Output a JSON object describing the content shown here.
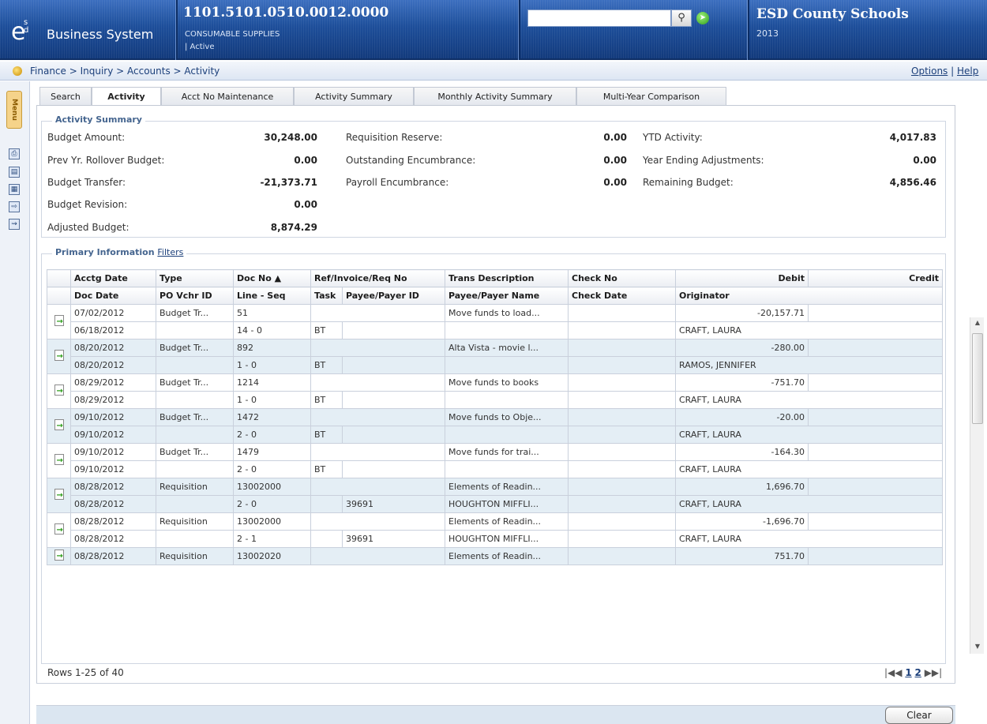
{
  "header": {
    "logo_text": "Business System",
    "account_number": "1101.5101.0510.0012.0000",
    "account_desc": "CONSUMABLE SUPPLIES",
    "account_status": "| Active",
    "district": "ESD County Schools",
    "year": "2013",
    "search_value": ""
  },
  "breadcrumb": "Finance > Inquiry > Accounts > Activity",
  "top_links": {
    "options": "Options",
    "sep": "|",
    "help": "Help"
  },
  "rail": {
    "menu_label": "Menu"
  },
  "tabs": [
    {
      "label": "Search"
    },
    {
      "label": "Activity"
    },
    {
      "label": "Acct No Maintenance"
    },
    {
      "label": "Activity Summary"
    },
    {
      "label": "Monthly Activity Summary"
    },
    {
      "label": "Multi-Year Comparison"
    }
  ],
  "summary": {
    "legend": "Activity Summary",
    "col1": [
      {
        "label": "Budget Amount:",
        "value": "30,248.00"
      },
      {
        "label": "Prev Yr. Rollover Budget:",
        "value": "0.00"
      },
      {
        "label": "Budget Transfer:",
        "value": "-21,373.71"
      },
      {
        "label": "Budget Revision:",
        "value": "0.00"
      },
      {
        "label": "Adjusted Budget:",
        "value": "8,874.29"
      }
    ],
    "col2": [
      {
        "label": "Requisition Reserve:",
        "value": "0.00"
      },
      {
        "label": "Outstanding Encumbrance:",
        "value": "0.00"
      },
      {
        "label": "Payroll Encumbrance:",
        "value": "0.00"
      }
    ],
    "col3": [
      {
        "label": "YTD Activity:",
        "value": "4,017.83"
      },
      {
        "label": "Year Ending Adjustments:",
        "value": "0.00"
      },
      {
        "label": "Remaining Budget:",
        "value": "4,856.46"
      }
    ]
  },
  "primary": {
    "legend": "Primary Information",
    "filters": "Filters"
  },
  "grid": {
    "headers1": [
      "Acctg Date",
      "Type",
      "Doc No",
      "Ref/Invoice/Req No",
      "Trans Description",
      "Check No",
      "Debit",
      "Credit"
    ],
    "headers2": [
      "Doc Date",
      "PO Vchr ID",
      "Line - Seq",
      "Task",
      "Payee/Payer ID",
      "Payee/Payer Name",
      "Check Date",
      "Originator"
    ],
    "sort_indicator": "▲",
    "rows": [
      {
        "acctg": "07/02/2012",
        "type": "Budget Tr...",
        "doc": "51",
        "desc": "Move funds to load...",
        "debit": "-20,157.71",
        "docdate": "06/18/2012",
        "line": "14 - 0",
        "task": "BT",
        "payid": "",
        "payname": "",
        "orig": "CRAFT, LAURA"
      },
      {
        "acctg": "08/20/2012",
        "type": "Budget Tr...",
        "doc": "892",
        "desc": "Alta Vista - movie l...",
        "debit": "-280.00",
        "docdate": "08/20/2012",
        "line": "1 - 0",
        "task": "BT",
        "payid": "",
        "payname": "",
        "orig": "RAMOS, JENNIFER"
      },
      {
        "acctg": "08/29/2012",
        "type": "Budget Tr...",
        "doc": "1214",
        "desc": "Move funds to books",
        "debit": "-751.70",
        "docdate": "08/29/2012",
        "line": "1 - 0",
        "task": "BT",
        "payid": "",
        "payname": "",
        "orig": "CRAFT, LAURA"
      },
      {
        "acctg": "09/10/2012",
        "type": "Budget Tr...",
        "doc": "1472",
        "desc": "Move funds to Obje...",
        "debit": "-20.00",
        "docdate": "09/10/2012",
        "line": "2 - 0",
        "task": "BT",
        "payid": "",
        "payname": "",
        "orig": "CRAFT, LAURA"
      },
      {
        "acctg": "09/10/2012",
        "type": "Budget Tr...",
        "doc": "1479",
        "desc": "Move funds for trai...",
        "debit": "-164.30",
        "docdate": "09/10/2012",
        "line": "2 - 0",
        "task": "BT",
        "payid": "",
        "payname": "",
        "orig": "CRAFT, LAURA"
      },
      {
        "acctg": "08/28/2012",
        "type": "Requisition",
        "doc": "13002000",
        "desc": "Elements of Readin...",
        "debit": "1,696.70",
        "docdate": "08/28/2012",
        "line": "2 - 0",
        "task": "",
        "payid": "39691",
        "payname": "HOUGHTON MIFFLI...",
        "orig": "CRAFT, LAURA"
      },
      {
        "acctg": "08/28/2012",
        "type": "Requisition",
        "doc": "13002000",
        "desc": "Elements of Readin...",
        "debit": "-1,696.70",
        "docdate": "08/28/2012",
        "line": "2 - 1",
        "task": "",
        "payid": "39691",
        "payname": "HOUGHTON MIFFLI...",
        "orig": "CRAFT, LAURA"
      },
      {
        "acctg": "08/28/2012",
        "type": "Requisition",
        "doc": "13002020",
        "desc": "Elements of Readin...",
        "debit": "751.70"
      }
    ]
  },
  "footer": {
    "rows_info": "Rows 1-25 of 40",
    "pager_nav": "|◀◀",
    "page1": "1",
    "page2": "2",
    "pager_next": "▶▶|",
    "clear_label": "Clear"
  }
}
